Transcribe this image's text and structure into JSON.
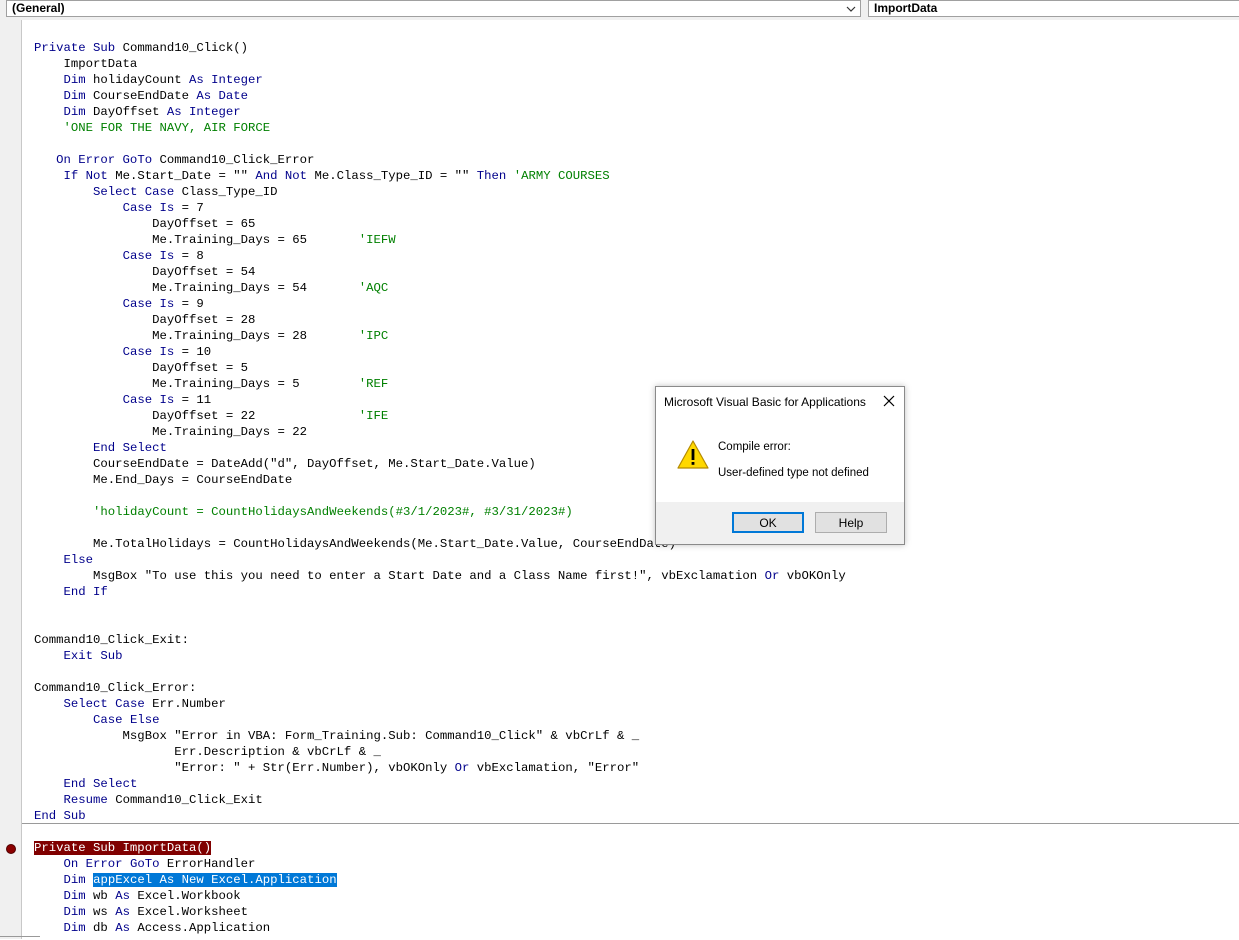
{
  "header": {
    "object_combo": "(General)",
    "procedure_combo": "ImportData"
  },
  "icons": {
    "dropdown": "chevron-down-icon",
    "breakpoint": "breakpoint-icon",
    "warning": "warning-icon",
    "close": "close-icon"
  },
  "colors": {
    "keyword": "#00008b",
    "comment": "#008000",
    "breakpoint_bg": "#800000",
    "selection_bg": "#0078d7"
  },
  "code_lines": [
    [
      {
        "t": "Private Sub",
        "c": "kw"
      },
      {
        "t": " Command10_Click()"
      }
    ],
    [
      {
        "t": "    ImportData"
      }
    ],
    [
      {
        "t": "    "
      },
      {
        "t": "Dim",
        "c": "kw"
      },
      {
        "t": " holidayCount "
      },
      {
        "t": "As Integer",
        "c": "kw"
      }
    ],
    [
      {
        "t": "    "
      },
      {
        "t": "Dim",
        "c": "kw"
      },
      {
        "t": " CourseEndDate "
      },
      {
        "t": "As Date",
        "c": "kw"
      }
    ],
    [
      {
        "t": "    "
      },
      {
        "t": "Dim",
        "c": "kw"
      },
      {
        "t": " DayOffset "
      },
      {
        "t": "As Integer",
        "c": "kw"
      }
    ],
    [
      {
        "t": "    "
      },
      {
        "t": "'ONE FOR THE NAVY, AIR FORCE",
        "c": "cm"
      }
    ],
    [
      {
        "t": ""
      }
    ],
    [
      {
        "t": "   "
      },
      {
        "t": "On Error GoTo",
        "c": "kw"
      },
      {
        "t": " Command10_Click_Error"
      }
    ],
    [
      {
        "t": "    "
      },
      {
        "t": "If Not",
        "c": "kw"
      },
      {
        "t": " Me.Start_Date = \"\" "
      },
      {
        "t": "And Not",
        "c": "kw"
      },
      {
        "t": " Me.Class_Type_ID = \"\" "
      },
      {
        "t": "Then",
        "c": "kw"
      },
      {
        "t": " "
      },
      {
        "t": "'ARMY COURSES",
        "c": "cm"
      }
    ],
    [
      {
        "t": "        "
      },
      {
        "t": "Select Case",
        "c": "kw"
      },
      {
        "t": " Class_Type_ID"
      }
    ],
    [
      {
        "t": "            "
      },
      {
        "t": "Case Is",
        "c": "kw"
      },
      {
        "t": " = 7"
      }
    ],
    [
      {
        "t": "                DayOffset = 65"
      }
    ],
    [
      {
        "t": "                Me.Training_Days = 65       "
      },
      {
        "t": "'IEFW",
        "c": "cm"
      }
    ],
    [
      {
        "t": "            "
      },
      {
        "t": "Case Is",
        "c": "kw"
      },
      {
        "t": " = 8"
      }
    ],
    [
      {
        "t": "                DayOffset = 54"
      }
    ],
    [
      {
        "t": "                Me.Training_Days = 54       "
      },
      {
        "t": "'AQC",
        "c": "cm"
      }
    ],
    [
      {
        "t": "            "
      },
      {
        "t": "Case Is",
        "c": "kw"
      },
      {
        "t": " = 9"
      }
    ],
    [
      {
        "t": "                DayOffset = 28"
      }
    ],
    [
      {
        "t": "                Me.Training_Days = 28       "
      },
      {
        "t": "'IPC",
        "c": "cm"
      }
    ],
    [
      {
        "t": "            "
      },
      {
        "t": "Case Is",
        "c": "kw"
      },
      {
        "t": " = 10"
      }
    ],
    [
      {
        "t": "                DayOffset = 5"
      }
    ],
    [
      {
        "t": "                Me.Training_Days = 5        "
      },
      {
        "t": "'REF",
        "c": "cm"
      }
    ],
    [
      {
        "t": "            "
      },
      {
        "t": "Case Is",
        "c": "kw"
      },
      {
        "t": " = 11"
      }
    ],
    [
      {
        "t": "                DayOffset = 22              "
      },
      {
        "t": "'IFE",
        "c": "cm"
      }
    ],
    [
      {
        "t": "                Me.Training_Days = 22"
      }
    ],
    [
      {
        "t": "        "
      },
      {
        "t": "End Select",
        "c": "kw"
      }
    ],
    [
      {
        "t": "        CourseEndDate = DateAdd(\"d\", DayOffset, Me.Start_Date.Value)"
      }
    ],
    [
      {
        "t": "        Me.End_Days = CourseEndDate"
      }
    ],
    [
      {
        "t": ""
      }
    ],
    [
      {
        "t": "        "
      },
      {
        "t": "'holidayCount = CountHolidaysAndWeekends(#3/1/2023#, #3/31/2023#)",
        "c": "cm"
      }
    ],
    [
      {
        "t": ""
      }
    ],
    [
      {
        "t": "        Me.TotalHolidays = CountHolidaysAndWeekends(Me.Start_Date.Value, CourseEndDate)"
      }
    ],
    [
      {
        "t": "    "
      },
      {
        "t": "Else",
        "c": "kw"
      }
    ],
    [
      {
        "t": "        MsgBox \"To use this you need to enter a Start Date and a Class Name first!\", vbExclamation "
      },
      {
        "t": "Or",
        "c": "kw"
      },
      {
        "t": " vbOKOnly"
      }
    ],
    [
      {
        "t": "    "
      },
      {
        "t": "End If",
        "c": "kw"
      }
    ],
    [
      {
        "t": ""
      }
    ],
    [
      {
        "t": ""
      }
    ],
    [
      {
        "t": "Command10_Click_Exit:"
      }
    ],
    [
      {
        "t": "    "
      },
      {
        "t": "Exit Sub",
        "c": "kw"
      }
    ],
    [
      {
        "t": ""
      }
    ],
    [
      {
        "t": "Command10_Click_Error:"
      }
    ],
    [
      {
        "t": "    "
      },
      {
        "t": "Select Case",
        "c": "kw"
      },
      {
        "t": " Err.Number"
      }
    ],
    [
      {
        "t": "        "
      },
      {
        "t": "Case Else",
        "c": "kw"
      }
    ],
    [
      {
        "t": "            MsgBox \"Error in VBA: Form_Training.Sub: Command10_Click\" & vbCrLf & _"
      }
    ],
    [
      {
        "t": "                   Err.Description & vbCrLf & _"
      }
    ],
    [
      {
        "t": "                   \"Error: \" + Str(Err.Number), vbOKOnly "
      },
      {
        "t": "Or",
        "c": "kw"
      },
      {
        "t": " vbExclamation, \"Error\""
      }
    ],
    [
      {
        "t": "    "
      },
      {
        "t": "End Select",
        "c": "kw"
      }
    ],
    [
      {
        "t": "    "
      },
      {
        "t": "Resume",
        "c": "kw"
      },
      {
        "t": " Command10_Click_Exit"
      }
    ],
    [
      {
        "t": "End Sub",
        "c": "kw"
      }
    ],
    [
      {
        "t": ""
      }
    ],
    [
      {
        "t": "Private Sub ImportData()",
        "c": "bp"
      }
    ],
    [
      {
        "t": "    "
      },
      {
        "t": "On Error GoTo",
        "c": "kw"
      },
      {
        "t": " ErrorHandler"
      }
    ],
    [
      {
        "t": "    "
      },
      {
        "t": "Dim",
        "c": "kw"
      },
      {
        "t": " "
      },
      {
        "t": "appExcel As New Excel.Application",
        "c": "sel"
      }
    ],
    [
      {
        "t": "    "
      },
      {
        "t": "Dim",
        "c": "kw"
      },
      {
        "t": " wb "
      },
      {
        "t": "As",
        "c": "kw"
      },
      {
        "t": " Excel.Workbook"
      }
    ],
    [
      {
        "t": "    "
      },
      {
        "t": "Dim",
        "c": "kw"
      },
      {
        "t": " ws "
      },
      {
        "t": "As",
        "c": "kw"
      },
      {
        "t": " Excel.Worksheet"
      }
    ],
    [
      {
        "t": "    "
      },
      {
        "t": "Dim",
        "c": "kw"
      },
      {
        "t": " db "
      },
      {
        "t": "As",
        "c": "kw"
      },
      {
        "t": " Access.Application"
      }
    ]
  ],
  "dialog": {
    "title": "Microsoft Visual Basic for Applications",
    "message_title": "Compile error:",
    "message": "User-defined type not defined",
    "ok_label": "OK",
    "help_label": "Help"
  }
}
